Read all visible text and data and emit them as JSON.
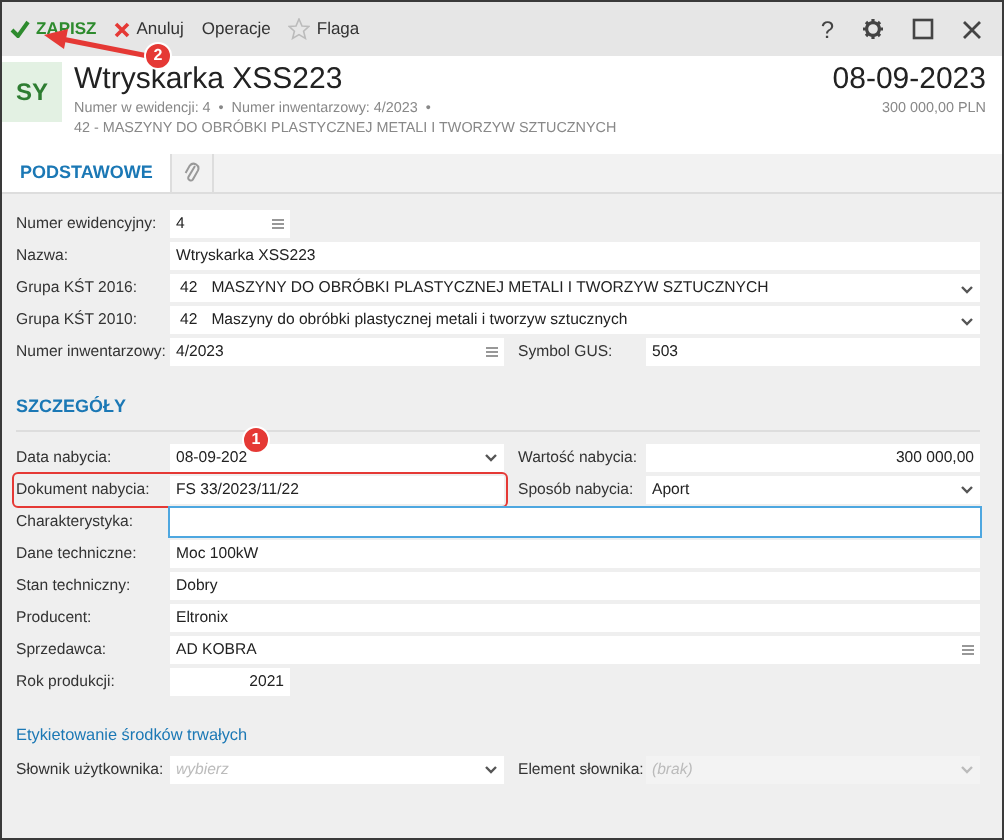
{
  "toolbar": {
    "buttons": [
      {
        "kind": "save",
        "label": "ZAPISZ",
        "badge": "2"
      },
      {
        "kind": "cancel",
        "label": "Anuluj"
      },
      {
        "kind": "plain",
        "label": "Operacje"
      },
      {
        "kind": "flag",
        "label": "Flaga"
      }
    ],
    "window_buttons": [
      {
        "kind": "help",
        "glyph": "?"
      },
      {
        "kind": "settings"
      },
      {
        "kind": "maximize"
      },
      {
        "kind": "close"
      }
    ]
  },
  "header": {
    "avatar": "SY",
    "title": "Wtryskarka XSS223",
    "meta": "Numer w ewidencji: 4  •  Numer inwentarzowy: 4/2023  •",
    "group": "42 - MASZYNY DO OBRÓBKI PLASTYCZNEJ METALI I TWORZYW SZTUCZNYCH",
    "date": "08-09-2023",
    "amount": "300 000,00 PLN"
  },
  "tabs": [
    {
      "kind": "text",
      "label": "PODSTAWOWE",
      "selected": true
    },
    {
      "kind": "attachment",
      "selected": false
    }
  ],
  "sections": [
    {
      "rows": [
        [
          {
            "label": "Numer ewidencyjny:",
            "kind": "lookup-short",
            "value": "4"
          }
        ],
        [
          {
            "label": "Nazwa:",
            "kind": "text",
            "value": "Wtryskarka XSS223"
          }
        ],
        [
          {
            "label": "Grupa KŚT 2016:",
            "kind": "select-coded",
            "code": "42",
            "value": "MASZYNY DO OBRÓBKI PLASTYCZNEJ METALI I TWORZYW SZTUCZNYCH"
          }
        ],
        [
          {
            "label": "Grupa KŚT 2010:",
            "kind": "select-coded",
            "code": "42",
            "value": "Maszyny do obróbki plastycznej metali i tworzyw sztucznych"
          }
        ],
        [
          {
            "label": "Numer inwentarzowy:",
            "kind": "lookup",
            "value": "4/2023"
          },
          {
            "label": "Symbol GUS:",
            "kind": "text",
            "value": "503"
          }
        ]
      ]
    },
    {
      "heading": "SZCZEGÓŁY",
      "kind": "main",
      "rows": [
        [
          {
            "label": "Data nabycia:",
            "kind": "select",
            "value": "08-09-202",
            "badge": "1"
          },
          {
            "label": "Wartość nabycia:",
            "kind": "number",
            "value": "300 000,00"
          }
        ],
        [
          {
            "label": "Dokument nabycia:",
            "kind": "text",
            "value": "FS 33/2023/11/22",
            "highlighted": true
          },
          {
            "label": "Sposób nabycia:",
            "kind": "select",
            "value": "Aport"
          }
        ],
        [
          {
            "label": "Charakterystyka:",
            "kind": "text",
            "focused": true
          }
        ],
        [
          {
            "label": "Dane techniczne:",
            "kind": "text",
            "value": "Moc 100kW"
          }
        ],
        [
          {
            "label": "Stan techniczny:",
            "kind": "text",
            "value": "Dobry"
          }
        ],
        [
          {
            "label": "Producent:",
            "kind": "text",
            "value": "Eltronix"
          }
        ],
        [
          {
            "label": "Sprzedawca:",
            "kind": "lookup",
            "value": "AD KOBRA"
          }
        ],
        [
          {
            "label": "Rok produkcji:",
            "kind": "number-short",
            "value": "2021"
          }
        ]
      ]
    },
    {
      "heading": "Etykietowanie środków trwałych",
      "kind": "sub",
      "rows": [
        [
          {
            "label": "Słownik użytkownika:",
            "kind": "select",
            "placeholder": "wybierz"
          },
          {
            "label": "Element słownika:",
            "kind": "select",
            "placeholder": "(brak)",
            "disabled": true
          }
        ]
      ]
    }
  ]
}
